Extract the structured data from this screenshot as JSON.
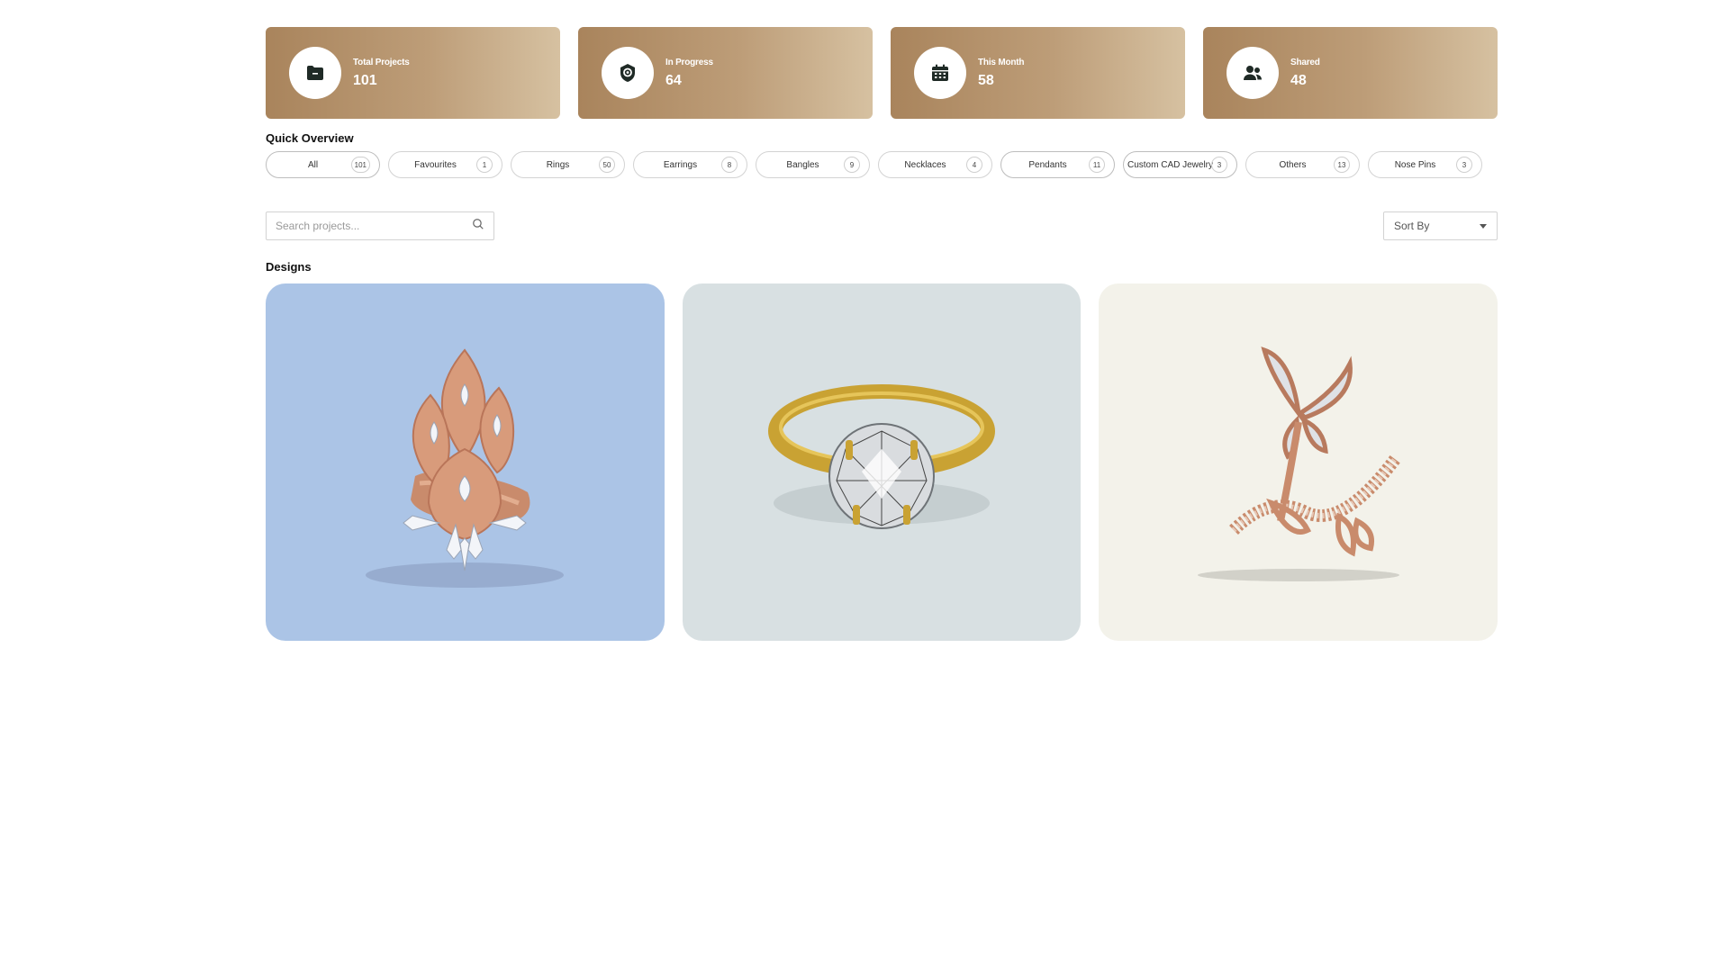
{
  "stats": [
    {
      "label": "Total Projects",
      "value": "101",
      "icon": "folder-icon"
    },
    {
      "label": "In Progress",
      "value": "64",
      "icon": "progress-icon"
    },
    {
      "label": "This Month",
      "value": "58",
      "icon": "calendar-icon"
    },
    {
      "label": "Shared",
      "value": "48",
      "icon": "users-icon"
    }
  ],
  "quick_overview": {
    "title": "Quick Overview",
    "chips": [
      {
        "label": "All",
        "count": "101"
      },
      {
        "label": "Favourites",
        "count": "1"
      },
      {
        "label": "Rings",
        "count": "50"
      },
      {
        "label": "Earrings",
        "count": "8"
      },
      {
        "label": "Bangles",
        "count": "9"
      },
      {
        "label": "Necklaces",
        "count": "4"
      },
      {
        "label": "Pendants",
        "count": "11"
      },
      {
        "label": "Custom CAD Jewelry",
        "count": "3"
      },
      {
        "label": "Others",
        "count": "13"
      },
      {
        "label": "Nose Pins",
        "count": "3"
      }
    ]
  },
  "toolbar": {
    "search_placeholder": "Search projects...",
    "sort_label": "Sort By"
  },
  "designs": {
    "title": "Designs",
    "cards": [
      {
        "background": "#abc4e6",
        "image": "rose-gold-leaf-cluster-ring"
      },
      {
        "background": "#d8e0e2",
        "image": "gold-solitaire-diamond-ring"
      },
      {
        "background": "#f3f2ea",
        "image": "rose-gold-butterfly-ring"
      }
    ]
  },
  "colors": {
    "card_gradient_start": "#a9845c",
    "card_gradient_end": "#d6c1a1",
    "icon_dark": "#1f2a26"
  }
}
